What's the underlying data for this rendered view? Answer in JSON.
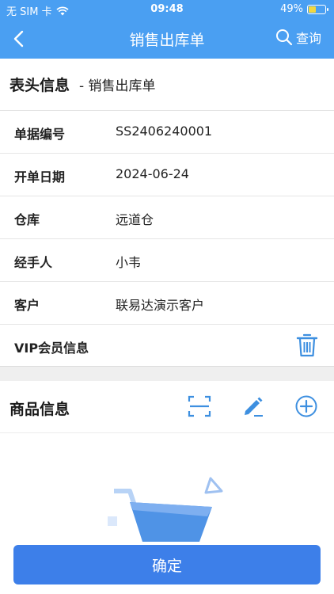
{
  "status_bar": {
    "carrier": "无 SIM 卡",
    "time": "09:48",
    "battery": "49%",
    "battery_level": 0.49
  },
  "navbar": {
    "title": "销售出库单",
    "query_label": "查询"
  },
  "header_section": {
    "title": "表头信息",
    "subtitle": "- 销售出库单"
  },
  "fields": [
    {
      "label": "单据编号",
      "value": "SS2406240001"
    },
    {
      "label": "开单日期",
      "value": "2024-06-24"
    },
    {
      "label": "仓库",
      "value": "远道仓"
    },
    {
      "label": "经手人",
      "value": "小韦"
    },
    {
      "label": "客户",
      "value": "联易达演示客户"
    },
    {
      "label": "VIP会员信息",
      "value": ""
    }
  ],
  "goods_section": {
    "title": "商品信息"
  },
  "footer": {
    "confirm_label": "确定"
  },
  "colors": {
    "primary": "#4a9ff2",
    "button": "#3d7fe9",
    "icon_blue": "#3d8fe0"
  }
}
